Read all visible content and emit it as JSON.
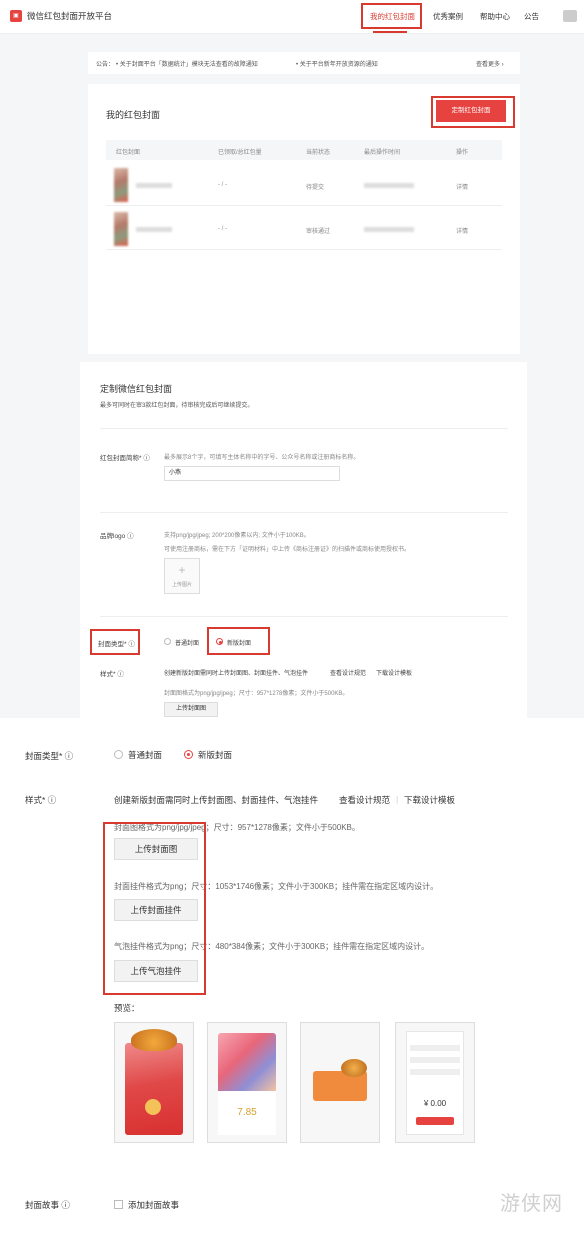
{
  "header": {
    "brand": "微信红包封面开放平台",
    "nav": [
      "我的红包封面",
      "优秀案例",
      "帮助中心",
      "公告"
    ]
  },
  "notice": {
    "prefix": "公告：",
    "item1": "关于封面平台「数据统计」模块无法查看的故障通知",
    "item2": "关于平台新年开放资源的通知",
    "more": "查看更多 ›"
  },
  "my_covers": {
    "title": "我的红包封面",
    "create_button": "定制红包封面",
    "columns": [
      "红包封面",
      "已领取/总红包量",
      "当前状态",
      "最后操作时间",
      "操作"
    ],
    "rows": [
      {
        "received": "- / -",
        "status": "待提交",
        "action": "详情"
      },
      {
        "received": "- / -",
        "status": "审核通过",
        "action": "详情"
      }
    ]
  },
  "customize": {
    "title": "定制微信红包封面",
    "subtitle": "最多可同时在审3款红包封面，待审核完成后可继续提交。",
    "name_label": "红包封面简称*",
    "name_hint": "最多展示8个字，可填写主体名称中的字号、公众号名称或注册商标名称。",
    "name_value": "小燕",
    "logo_label": "品牌logo",
    "logo_hint1": "支持png/jpg/jpeg; 200*200像素以内; 文件小于100KB。",
    "logo_hint2": "可使用注册商标，需在下方「证明材料」中上传《商标注册证》的扫描件或商标使用授权书。",
    "upload_image": "上传图片",
    "type_label": "封面类型*",
    "type_normal": "普通封面",
    "type_new": "新版封面",
    "style_label": "样式*",
    "style_hint": "创建新版封面需同时上传封面图、封面挂件、气泡挂件",
    "view_spec": "查看设计规范",
    "download_template": "下载设计模板",
    "cover_format": "封面图格式为png/jpg/jpeg；尺寸：957*1278像素；文件小于500KB。",
    "upload_cover": "上传封面图"
  },
  "zoom": {
    "type_label": "封面类型*",
    "type_normal": "普通封面",
    "type_new": "新版封面",
    "style_label": "样式*",
    "style_hint": "创建新版封面需同时上传封面图、封面挂件、气泡挂件",
    "view_spec": "查看设计规范",
    "download_template": "下载设计模板",
    "cover_format": "封面图格式为png/jpg/jpeg；尺寸：957*1278像素；文件小于500KB。",
    "upload_cover": "上传封面图",
    "pendant_format": "封面挂件格式为png；尺寸：1053*1746像素；文件小于300KB；挂件需在指定区域内设计。",
    "upload_pendant": "上传封面挂件",
    "bubble_format": "气泡挂件格式为png；尺寸：480*384像素；文件小于300KB；挂件需在指定区域内设计。",
    "upload_bubble": "上传气泡挂件",
    "preview_label": "预览：",
    "preview_amount": "7.85",
    "preview_amount2": "¥ 0.00",
    "story_label": "封面故事",
    "story_checkbox": "添加封面故事"
  },
  "watermark": "游侠网",
  "colors": {
    "accent": "#e64340",
    "annotation": "#d93a2f"
  }
}
